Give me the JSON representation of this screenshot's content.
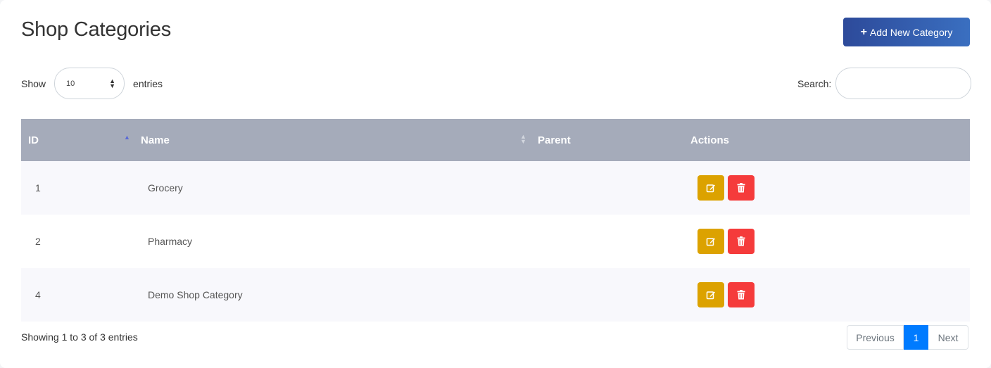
{
  "page": {
    "title": "Shop Categories",
    "add_button_label": "Add New Category",
    "add_button_icon": "plus-icon"
  },
  "length": {
    "label_before": "Show",
    "selected": "10",
    "label_after": "entries"
  },
  "search": {
    "label": "Search:",
    "value": ""
  },
  "table": {
    "columns": [
      "ID",
      "Name",
      "Parent",
      "Actions"
    ],
    "sorted_column": "ID",
    "sort_direction": "ascending",
    "rows": [
      {
        "id": "1",
        "name": "Grocery",
        "parent": ""
      },
      {
        "id": "2",
        "name": "Pharmacy",
        "parent": ""
      },
      {
        "id": "4",
        "name": "Demo Shop Category",
        "parent": ""
      }
    ],
    "row_actions": [
      "edit-icon",
      "trash-icon"
    ]
  },
  "footer": {
    "info": "Showing 1 to 3 of 3 entries",
    "pagination": {
      "previous": "Previous",
      "current": "1",
      "next": "Next"
    }
  },
  "colors": {
    "header_bg": "#a5abba",
    "primary_gradient_start": "#2d4a9a",
    "primary_gradient_end": "#3a6fc0",
    "edit": "#dca200",
    "delete": "#f53b3b",
    "page_active": "#007bff"
  }
}
